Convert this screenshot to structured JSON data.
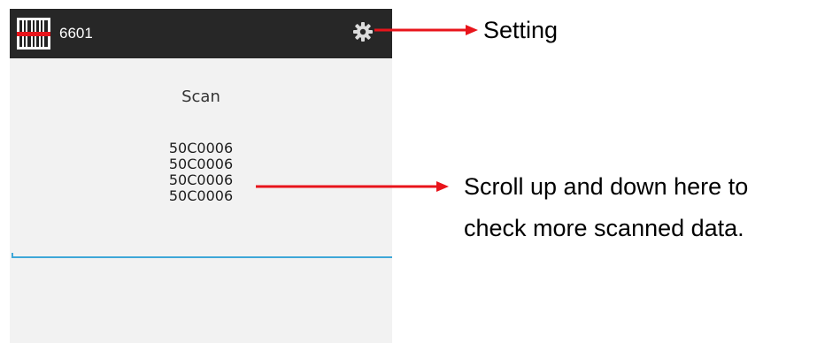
{
  "app": {
    "title": "6601",
    "app_icon": "barcode-icon",
    "settings_icon": "gear-icon"
  },
  "main": {
    "scan_label": "Scan",
    "scanned_items": [
      "50C0006",
      "50C0006",
      "50C0006",
      "50C0006"
    ]
  },
  "annotations": {
    "setting_label": "Setting",
    "scroll_hint_line1": "Scroll up and down here to",
    "scroll_hint_line2": "check more scanned data."
  },
  "colors": {
    "appbar": "#272727",
    "background": "#f2f2f2",
    "accent_line": "#3ea7d8",
    "arrow": "#e8141b"
  }
}
